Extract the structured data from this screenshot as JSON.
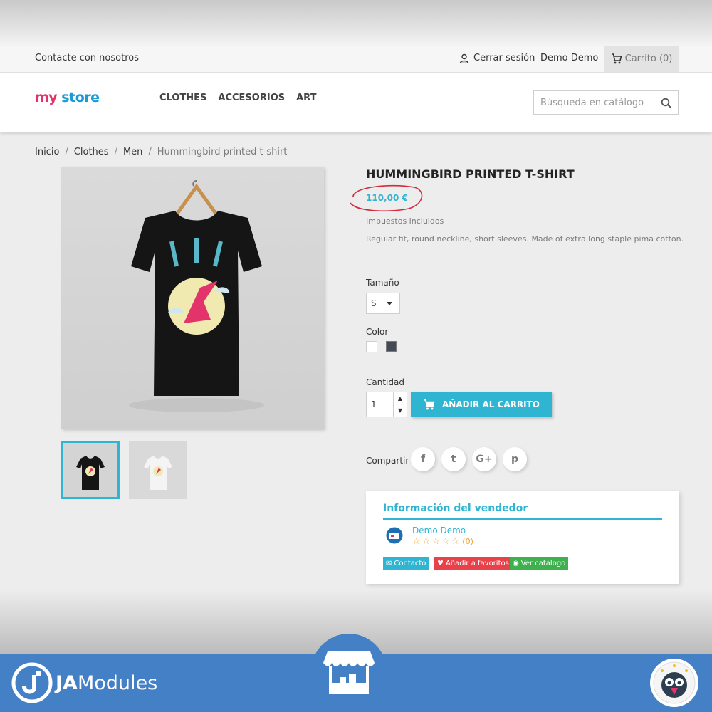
{
  "topbar": {
    "contact": "Contacte con nosotros",
    "logout": "Cerrar sesión",
    "user": "Demo Demo",
    "cart": "Carrito (0)"
  },
  "header": {
    "logo": {
      "part1": "my",
      "part2": " store"
    },
    "menu": [
      "CLOTHES",
      "ACCESORIOS",
      "ART"
    ],
    "search_placeholder": "Búsqueda en catálogo"
  },
  "breadcrumb": [
    "Inicio",
    "Clothes",
    "Men",
    "Hummingbird printed t-shirt"
  ],
  "product": {
    "title": "HUMMINGBIRD PRINTED T-SHIRT",
    "price": "110,00 €",
    "tax": "Impuestos incluidos",
    "description": "Regular fit, round neckline, short sleeves. Made of extra long staple pima cotton.",
    "size_label": "Tamaño",
    "size_value": "S",
    "color_label": "Color",
    "colors": [
      "#ffffff",
      "#434a54"
    ],
    "qty_label": "Cantidad",
    "qty_value": "1",
    "add_to_cart": "AÑADIR AL CARRITO",
    "share_label": "Compartir",
    "social": [
      "f",
      "t",
      "G+",
      "p"
    ]
  },
  "seller": {
    "title": "Información del vendedor",
    "name": "Demo Demo",
    "rating_count": "(0)",
    "buttons": {
      "contact": "Contacto",
      "favorite": "Añadir a favoritos",
      "catalog": "Ver catálogo"
    }
  },
  "footer": {
    "brand_bold": "JA",
    "brand_rest": "Modules"
  },
  "colors": {
    "accent": "#2fb5d2",
    "footer": "#4480c6",
    "favorite": "#e8414a",
    "catalog": "#3fb04e"
  }
}
